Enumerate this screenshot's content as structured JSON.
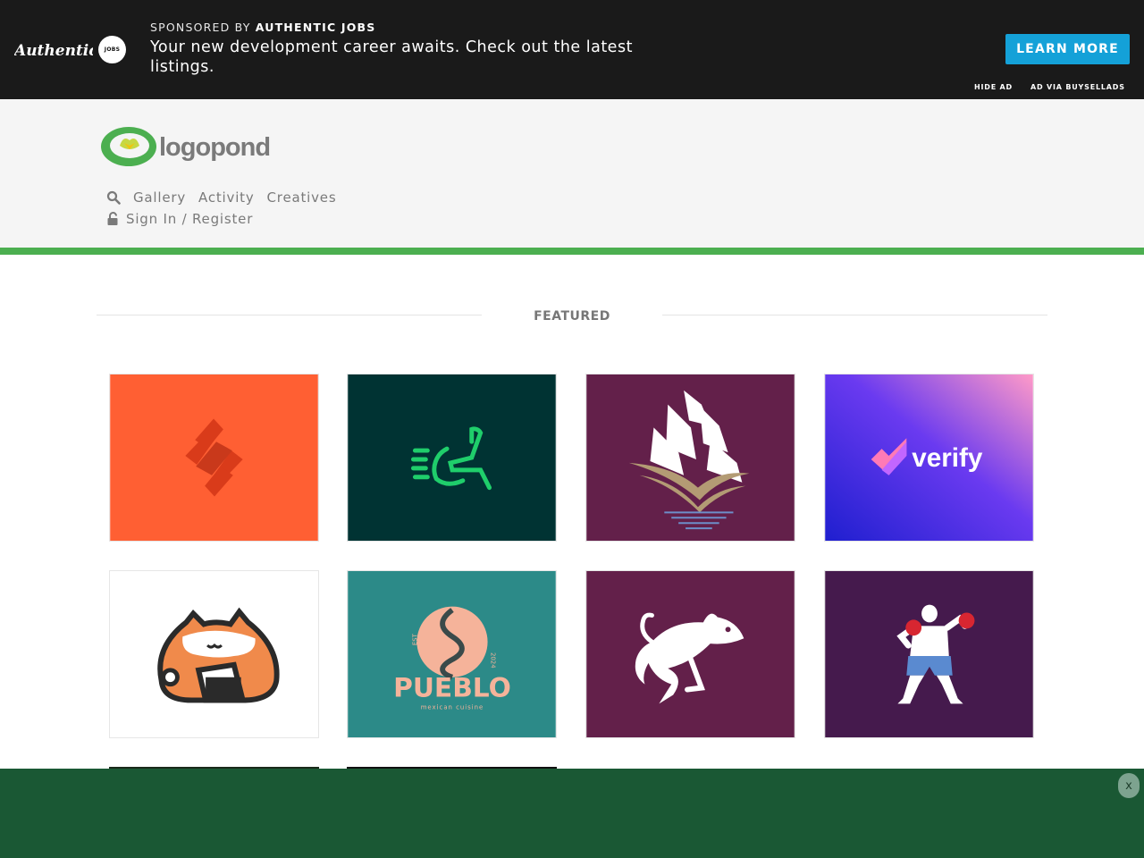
{
  "ad": {
    "sponsor_prefix": "SPONSORED BY",
    "sponsor_name": "AUTHENTIC JOBS",
    "logo_text": "Authentic",
    "jobs_badge": "JOBS",
    "message": "Your new development career awaits. Check out the latest listings.",
    "cta": "LEARN MORE",
    "hide": "HIDE AD",
    "via": "AD VIA BUYSELLADS",
    "button_color": "#14a1d8"
  },
  "header": {
    "logo_text": "logopond",
    "nav": [
      {
        "label": "Gallery"
      },
      {
        "label": "Activity"
      },
      {
        "label": "Creatives"
      }
    ],
    "auth_label": "Sign In / Register",
    "accent_color": "#4caf50"
  },
  "featured": {
    "title": "FEATURED",
    "tiles": [
      {
        "name": "tile-orange-diamond",
        "bg": "#ff5f33",
        "icon": "abstract-diamond-logo"
      },
      {
        "name": "tile-green-chair",
        "bg": "#003333",
        "icon": "speed-wheelchair-logo"
      },
      {
        "name": "tile-ship",
        "bg": "#63204a",
        "icon": "sailing-ship-logo"
      },
      {
        "name": "tile-verify",
        "bg": "#4b2ee0",
        "icon": "verify-check-logo",
        "text": "verify"
      },
      {
        "name": "tile-cat",
        "bg": "#ffffff",
        "icon": "onigiri-cat-logo"
      },
      {
        "name": "tile-pueblo",
        "bg": "#2c8a88",
        "icon": "pueblo-serpent-logo",
        "text": "PUEBLO",
        "subtext": "mexican cuisine"
      },
      {
        "name": "tile-rat",
        "bg": "#63204a",
        "icon": "jumping-rat-logo"
      },
      {
        "name": "tile-boxer",
        "bg": "#451a4d",
        "icon": "boxer-logo"
      }
    ]
  },
  "bottom_ad": {
    "close": "x",
    "bg": "#1a5834"
  }
}
